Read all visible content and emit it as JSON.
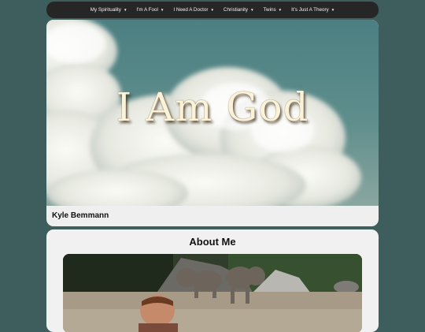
{
  "nav": {
    "items": [
      {
        "label": "My Spirituality",
        "caret": "▼"
      },
      {
        "label": "I'm A Fool",
        "caret": "▼"
      },
      {
        "label": "I Need A Doctor",
        "caret": "▼"
      },
      {
        "label": "Christianity",
        "caret": "▼"
      },
      {
        "label": "Twins",
        "caret": "▼"
      },
      {
        "label": "It's Just A Theory",
        "caret": "▼"
      }
    ]
  },
  "hero": {
    "title": "I Am God",
    "author": "Kyle Bemmann"
  },
  "about": {
    "title": "About Me"
  },
  "colors": {
    "page_bg": "#3e5e5e",
    "nav_bg": "#262626",
    "card_bg": "#efefef"
  }
}
